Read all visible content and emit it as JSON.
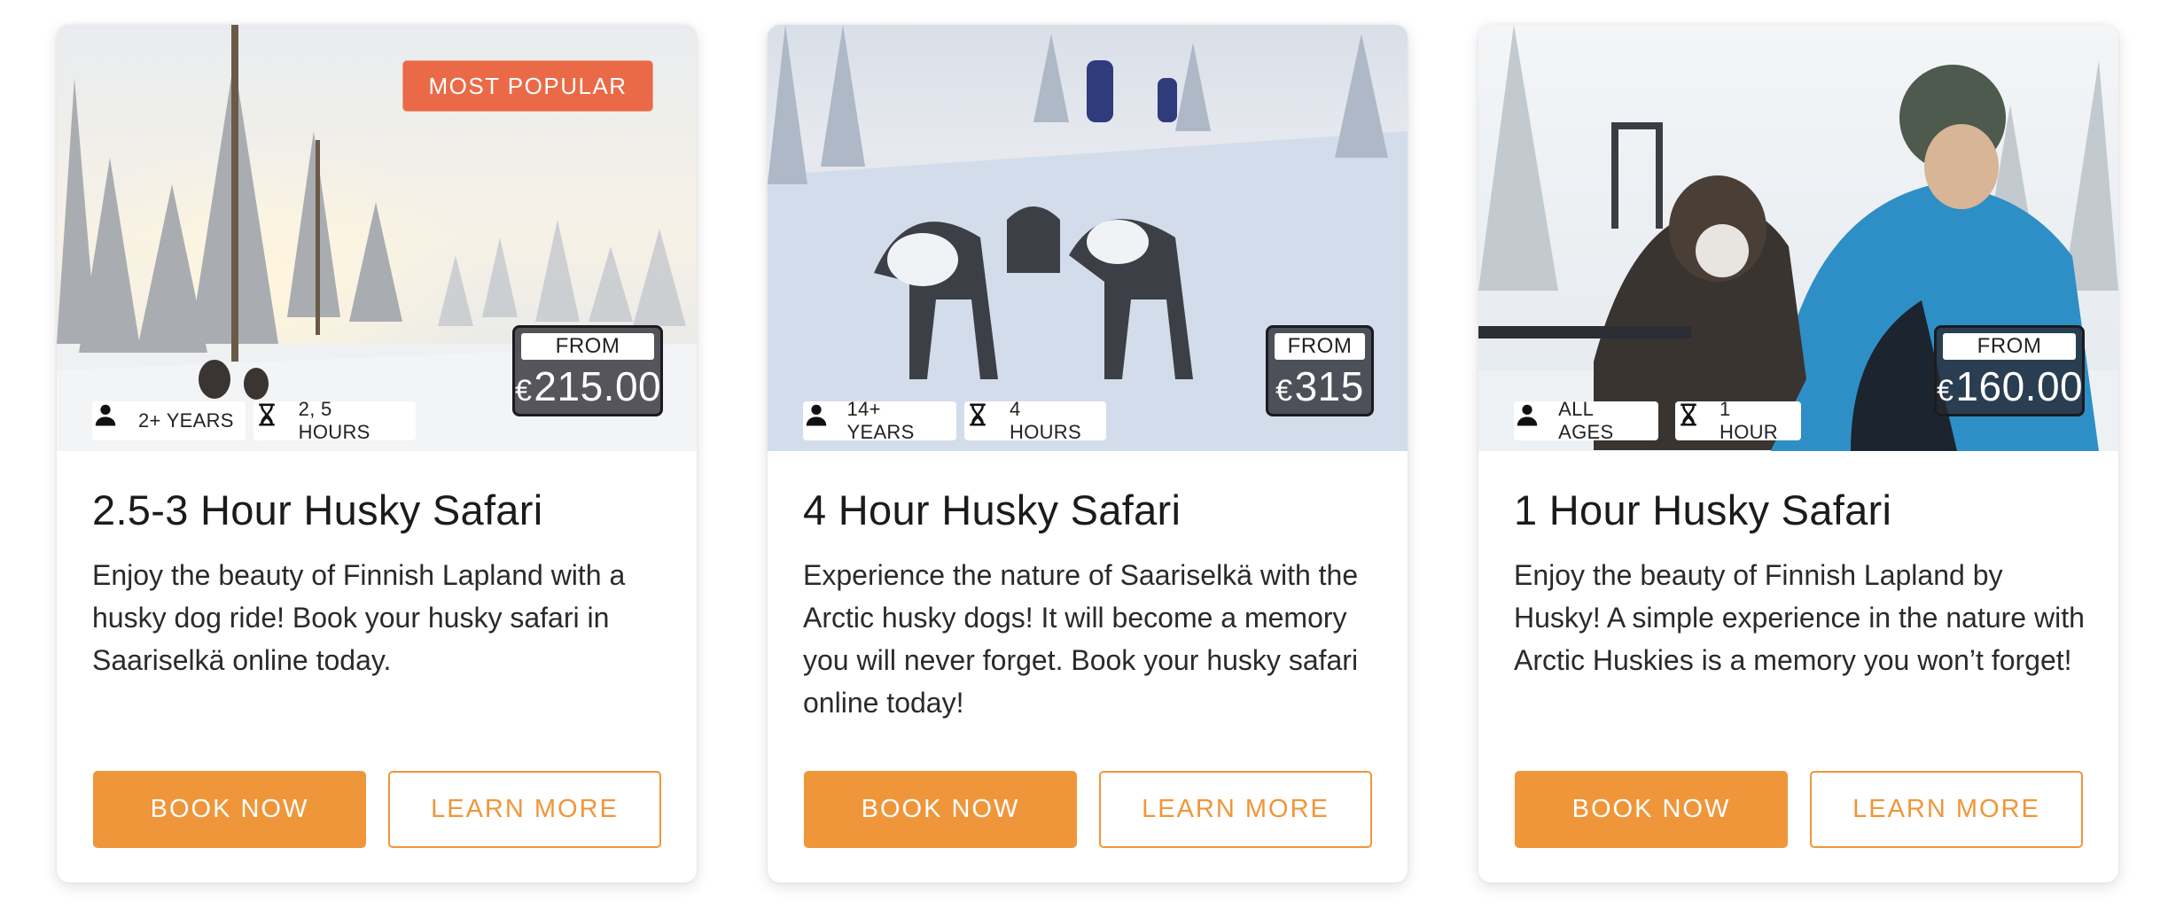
{
  "cards": [
    {
      "badge": "MOST POPULAR",
      "age": "2+ YEARS",
      "duration": "2, 5 HOURS",
      "price_from": "FROM",
      "currency": "€",
      "price": "215.00",
      "title": "2.5-3 Hour Husky Safari",
      "description": "Enjoy the beauty of Finnish Lapland with a husky dog ride! Book your husky safari in Saariselkä online today.",
      "book_label": "BOOK NOW",
      "learn_label": "LEARN MORE"
    },
    {
      "age": "14+ YEARS",
      "duration": "4 HOURS",
      "price_from": "FROM",
      "currency": "€",
      "price": "315",
      "title": "4 Hour Husky Safari",
      "description": "Experience the nature of Saariselkä with the Arctic husky dogs! It will become a memory you will never forget. Book your husky safari online today!",
      "book_label": "BOOK NOW",
      "learn_label": "LEARN MORE"
    },
    {
      "age": "ALL AGES",
      "duration": "1 HOUR",
      "price_from": "FROM",
      "currency": "€",
      "price": "160.00",
      "title": "1 Hour Husky Safari",
      "description": "Enjoy the beauty of Finnish Lapland by Husky! A simple experience in the nature with Arctic Huskies is a memory you won’t forget!",
      "book_label": "BOOK NOW",
      "learn_label": "LEARN MORE"
    }
  ],
  "icons": {
    "age": "person-icon",
    "duration": "hourglass-icon"
  },
  "colors": {
    "accent": "#f0963a",
    "badge": "#ea6a47",
    "title": "#1b1b1b"
  }
}
